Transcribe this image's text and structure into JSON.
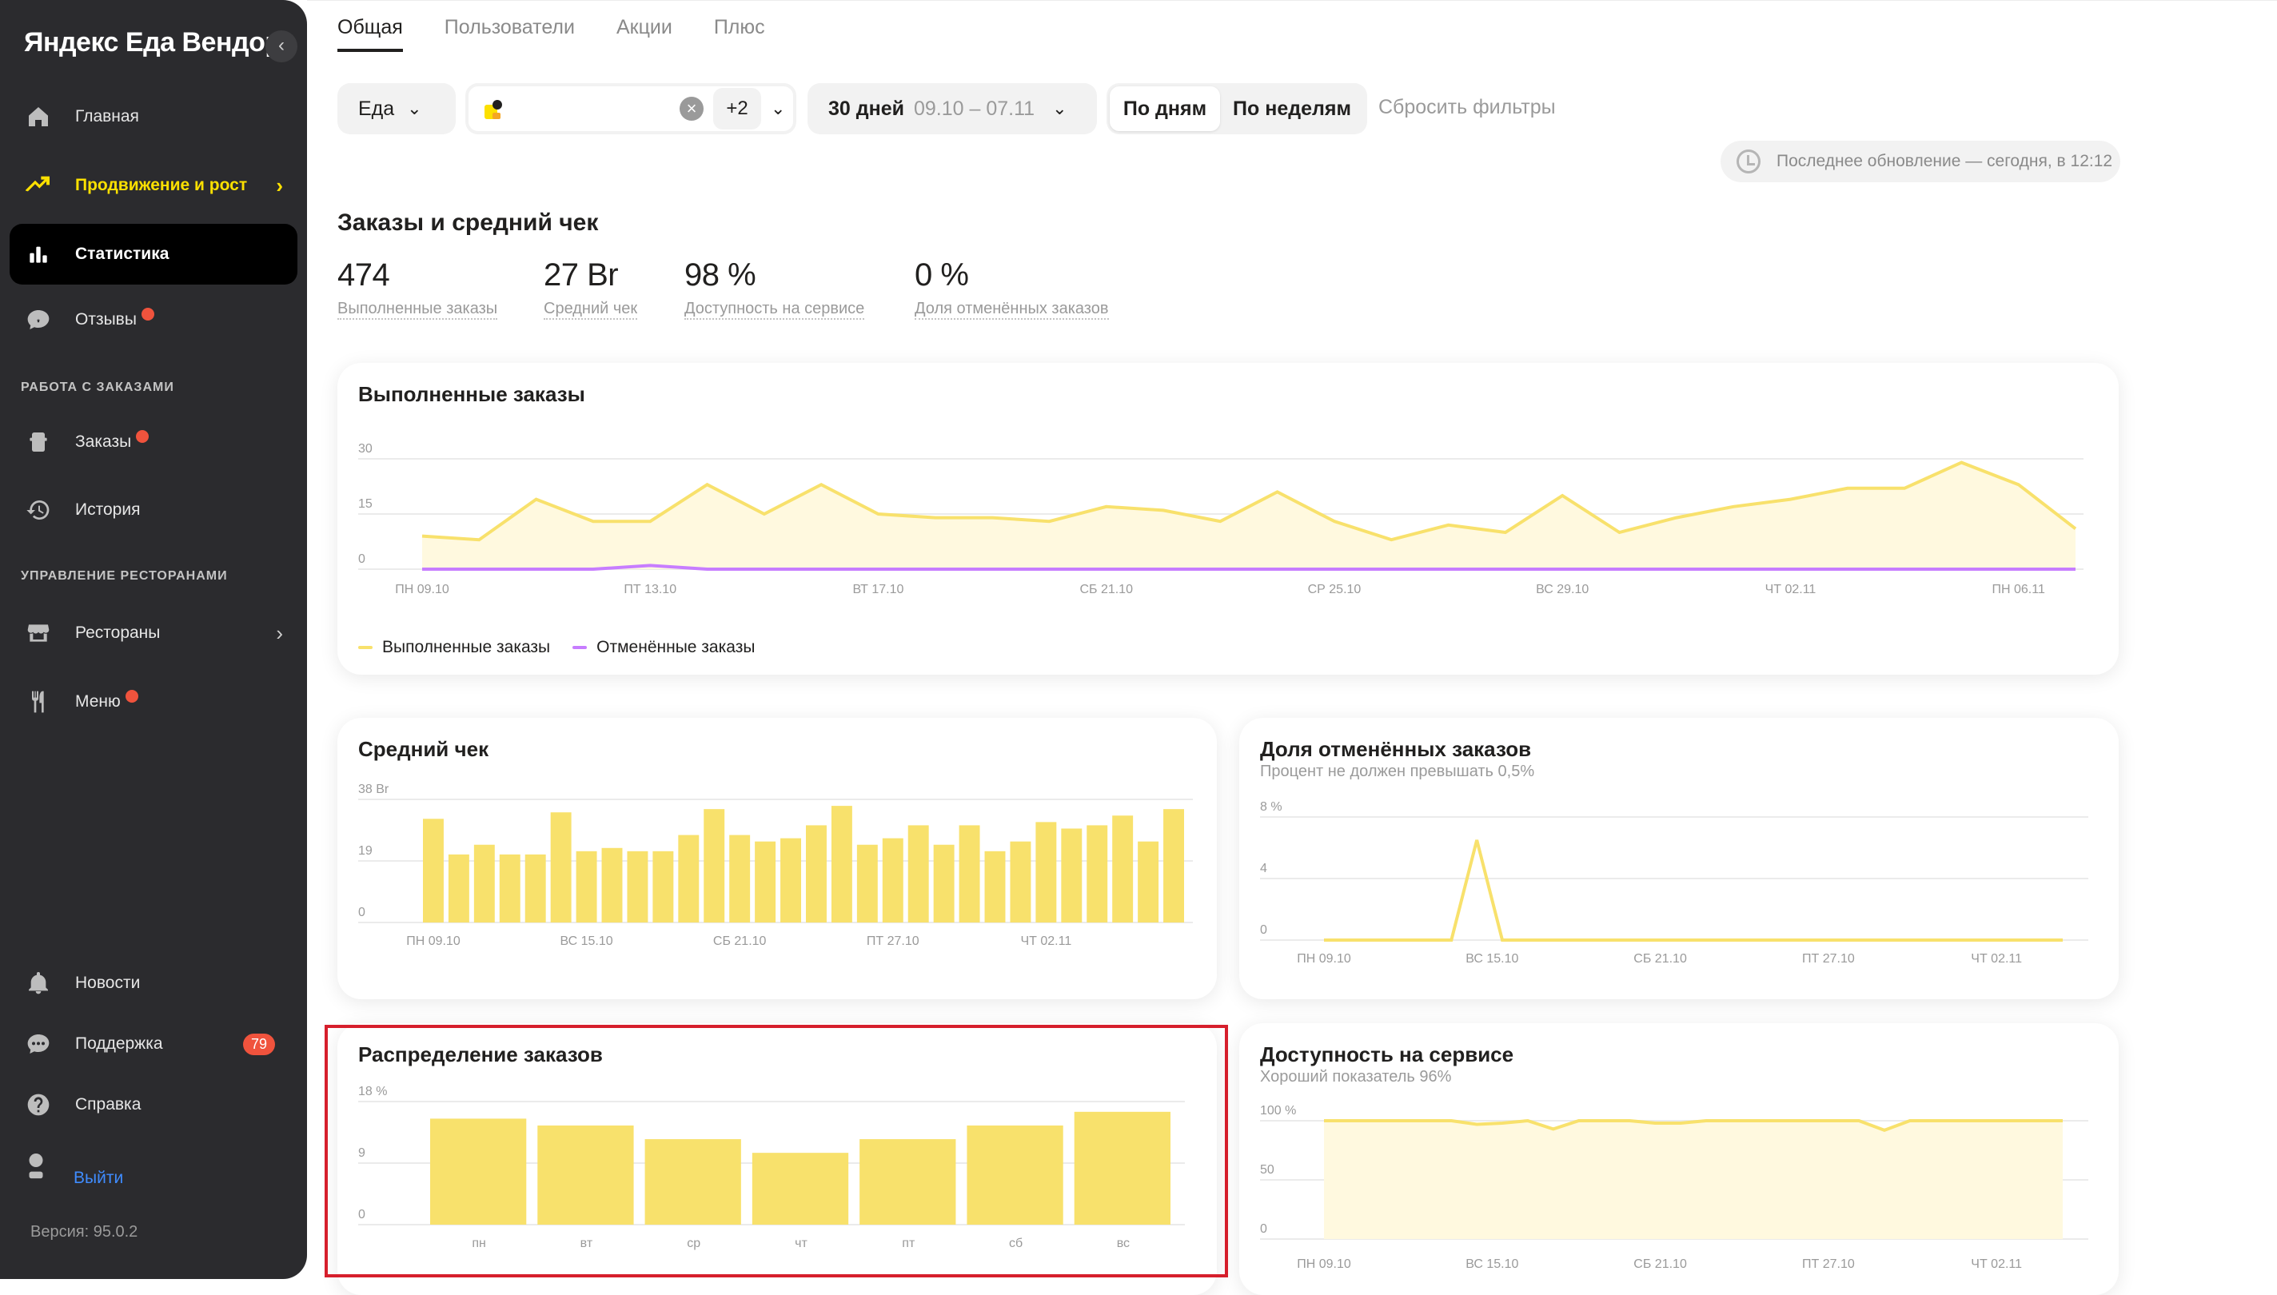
{
  "sidebar": {
    "brand": "Яндекс Еда Вендор",
    "collapse_icon": "‹",
    "items": {
      "home": "Главная",
      "promo": "Продвижение и рост",
      "stats": "Статистика",
      "reviews": "Отзывы",
      "orders": "Заказы",
      "history": "История",
      "restaurants": "Рестораны",
      "menu": "Меню",
      "news": "Новости",
      "support": "Поддержка",
      "help": "Справка"
    },
    "section_orders": "РАБОТА С ЗАКАЗАМИ",
    "section_restaurants": "УПРАВЛЕНИЕ РЕСТОРАНАМИ",
    "support_badge": "79",
    "logout": "Выйти",
    "version": "Версия: 95.0.2"
  },
  "tabs": [
    "Общая",
    "Пользователи",
    "Акции",
    "Плюс"
  ],
  "filters": {
    "service": "Еда",
    "restaurants_more": "+2",
    "period": "30 дней",
    "period_range": "09.10 – 07.11",
    "by_days": "По дням",
    "by_weeks": "По неделям",
    "reset": "Сбросить фильтры",
    "last_update": "Последнее обновление — сегодня, в 12:12"
  },
  "summary": {
    "title": "Заказы и средний чек",
    "stats": [
      {
        "value": "474",
        "label": "Выполненные заказы"
      },
      {
        "value": "27 Br",
        "label": "Средний чек"
      },
      {
        "value": "98 %",
        "label": "Доступность на сервисе"
      },
      {
        "value": "0 %",
        "label": "Доля отменённых заказов"
      }
    ]
  },
  "colors": {
    "accent": "#fce000",
    "bar": "#f8e16c",
    "cancel": "#c77dff",
    "alert": "#f0533d",
    "sidebar": "#2b2b2e"
  },
  "chart_data": [
    {
      "type": "line",
      "title": "Выполненные заказы",
      "ylim": [
        0,
        30
      ],
      "y_ticks": [
        "30",
        "15",
        "0"
      ],
      "x_tick_labels": [
        "ПН 09.10",
        "ПТ 13.10",
        "ВТ 17.10",
        "СБ 21.10",
        "СР 25.10",
        "ВС 29.10",
        "ЧТ 02.11",
        "ПН 06.11"
      ],
      "series": [
        {
          "name": "Выполненные заказы",
          "values": [
            9,
            8,
            19,
            13,
            13,
            23,
            15,
            23,
            15,
            14,
            14,
            13,
            17,
            16,
            13,
            21,
            13,
            8,
            12,
            10,
            20,
            10,
            14,
            17,
            19,
            22,
            22,
            29,
            23,
            11
          ]
        },
        {
          "name": "Отменённые заказы",
          "values": [
            0,
            0,
            0,
            0,
            1,
            0,
            0,
            0,
            0,
            0,
            0,
            0,
            0,
            0,
            0,
            0,
            0,
            0,
            0,
            0,
            0,
            0,
            0,
            0,
            0,
            0,
            0,
            0,
            0,
            0
          ]
        }
      ]
    },
    {
      "type": "bar",
      "title": "Средний чек",
      "ylim": [
        0,
        38
      ],
      "y_ticks": [
        "38 Br",
        "19",
        "0"
      ],
      "x_tick_labels": [
        "ПН 09.10",
        "ВС 15.10",
        "СБ 21.10",
        "ПТ 27.10",
        "ЧТ 02.11"
      ],
      "values": [
        32,
        21,
        24,
        21,
        21,
        34,
        22,
        23,
        22,
        22,
        27,
        35,
        27,
        25,
        26,
        30,
        36,
        24,
        26,
        30,
        24,
        30,
        22,
        25,
        31,
        29,
        30,
        33,
        25,
        35
      ]
    },
    {
      "type": "line",
      "title": "Доля отменённых заказов",
      "subtitle": "Процент не должен превышать 0,5%",
      "ylim": [
        0,
        8
      ],
      "y_ticks": [
        "8 %",
        "4",
        "0"
      ],
      "x_tick_labels": [
        "ПН 09.10",
        "ВС 15.10",
        "СБ 21.10",
        "ПТ 27.10",
        "ЧТ 02.11"
      ],
      "values": [
        0,
        0,
        0,
        0,
        0,
        0,
        6.5,
        0,
        0,
        0,
        0,
        0,
        0,
        0,
        0,
        0,
        0,
        0,
        0,
        0,
        0,
        0,
        0,
        0,
        0,
        0,
        0,
        0,
        0,
        0
      ]
    },
    {
      "type": "bar",
      "title": "Распределение заказов",
      "ylim": [
        0,
        18
      ],
      "y_ticks": [
        "18 %",
        "9",
        "0"
      ],
      "categories": [
        "пн",
        "вт",
        "ср",
        "чт",
        "пт",
        "сб",
        "вс"
      ],
      "values": [
        15.5,
        14.5,
        12.5,
        10.5,
        12.5,
        14.5,
        16.5
      ]
    },
    {
      "type": "area",
      "title": "Доступность на сервисе",
      "subtitle": "Хороший показатель 96%",
      "ylim": [
        0,
        100
      ],
      "y_ticks": [
        "100 %",
        "50",
        "0"
      ],
      "x_tick_labels": [
        "ПН 09.10",
        "ВС 15.10",
        "СБ 21.10",
        "ПТ 27.10",
        "ЧТ 02.11"
      ],
      "values": [
        100,
        100,
        100,
        100,
        100,
        100,
        97,
        98,
        100,
        93,
        100,
        100,
        100,
        98,
        98,
        100,
        100,
        100,
        100,
        100,
        100,
        100,
        92,
        100,
        100,
        100,
        100,
        100,
        100,
        100
      ]
    }
  ]
}
